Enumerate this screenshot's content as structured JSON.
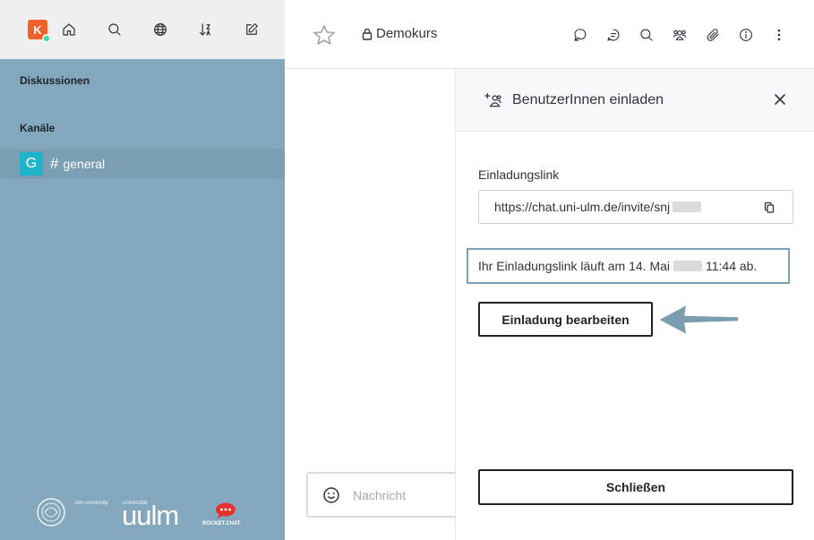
{
  "user": {
    "avatar_letter": "K"
  },
  "sidebar": {
    "sections": [
      "Diskussionen",
      "Kanäle"
    ],
    "channel": {
      "avatar_letter": "G",
      "hash": "#",
      "name": "general"
    },
    "footer": {
      "uni_small": "ulm university",
      "uni_label": "universität",
      "uni_big": "uulm",
      "rc_label": "ROCKET.CHAT"
    }
  },
  "header": {
    "room_name": "Demokurs"
  },
  "composer": {
    "placeholder": "Nachricht"
  },
  "invite_panel": {
    "title": "BenutzerInnen einladen",
    "link_label": "Einladungslink",
    "link_value": "https://chat.uni-ulm.de/invite/snj",
    "expiry_prefix": "Ihr Einladungslink läuft am 14. Mai",
    "expiry_suffix": "11:44 ab.",
    "edit_button": "Einladung bearbeiten",
    "close_button": "Schließen"
  },
  "colors": {
    "sidebar_bg": "#83a8bd",
    "avatar": "#f0622a",
    "channel_avatar": "#1fb4ca",
    "highlight_border": "#7d9fb1",
    "arrow": "#7c9db0"
  }
}
